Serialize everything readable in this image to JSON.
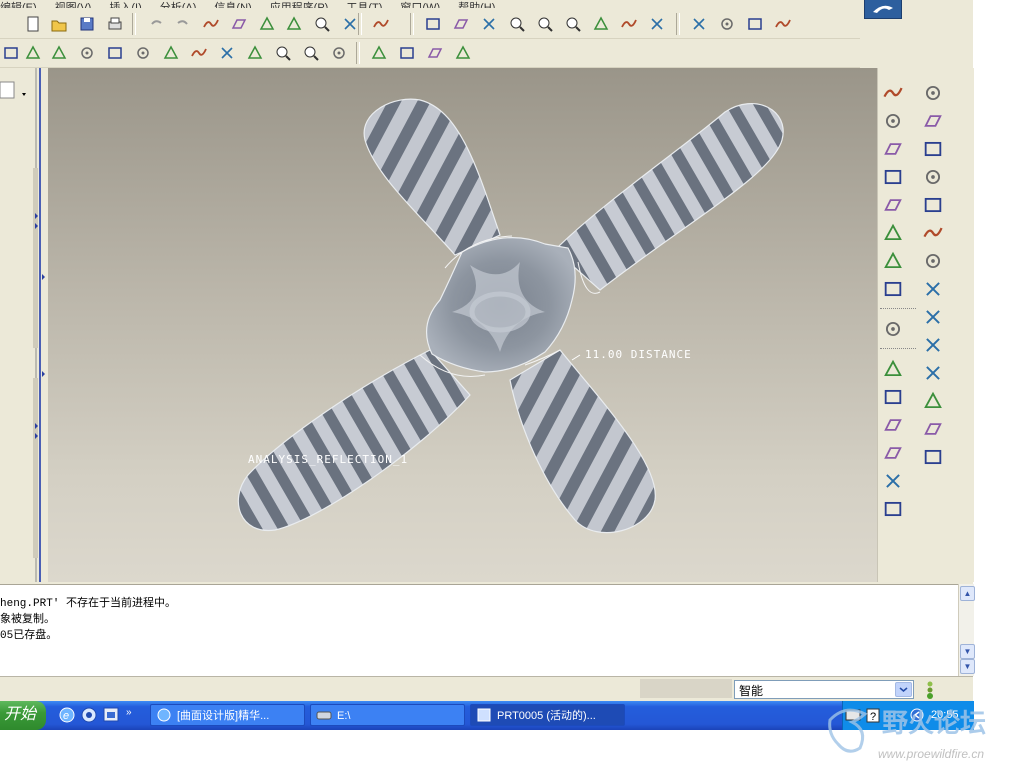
{
  "menubar": {
    "items": [
      "编辑(E)",
      "视图(V)",
      "插入(I)",
      "分析(A)",
      "信息(N)",
      "应用程序(P)",
      "工具(T)",
      "窗口(W)",
      "帮助(H)"
    ]
  },
  "toolbar": {
    "row1": [
      "new-icon",
      "open-icon",
      "save-icon",
      "print-icon",
      "undo-icon",
      "redo-icon",
      "cut-icon",
      "copy-icon",
      "paste-icon",
      "paste-special-icon",
      "find-icon",
      "regenerate-icon",
      "select-box-icon",
      "spin-center-icon",
      "orient-icon",
      "datum-display-icon",
      "zoom-in-icon",
      "zoom-out-icon",
      "refit-icon",
      "repaint-icon",
      "saved-views-icon",
      "layers-icon",
      "wireframe-icon",
      "hidden-line-icon",
      "no-hidden-icon",
      "shading-icon"
    ],
    "row2": [
      "draft-analysis-icon",
      "section-icon",
      "curvature-icon",
      "reflection-icon",
      "shade-analysis-icon",
      "offset-icon",
      "dihedral-icon",
      "ruler-icon",
      "measure-icon",
      "pick-icon",
      "inspect-icon",
      "zoom-detail-icon",
      "close-window-icon",
      "datum-plane-display-icon",
      "axis-display-icon",
      "point-display-icon",
      "csys-display-icon"
    ]
  },
  "viewport": {
    "annotation_reflection": "ANALYSIS_REFLECTION_1",
    "annotation_distance": "11.00  DISTANCE"
  },
  "rightbar": {
    "col1": [
      "datum-point-icon",
      "datum-axis-icon",
      "datum-curve-icon",
      "datum-plane-icon",
      "sketch-line-icon",
      "spline-icon",
      "intersect-icon",
      "offset-point-icon",
      "annotation-icon",
      "extrude-icon",
      "shell-icon",
      "draft-icon",
      "rib-icon",
      "round-icon",
      "chamfer-icon"
    ],
    "col2": [
      "coord-icon",
      "rotate-icon",
      "sweep-icon",
      "blend-icon",
      "boundary-icon",
      "pattern-icon",
      "copy-surface-icon",
      "merge-icon",
      "trim-icon",
      "extend-icon",
      "thicken-icon",
      "solidify-icon",
      "add-icon",
      "cylinder-icon"
    ]
  },
  "messages": [
    {
      "text": "heng.PRT' 不存在于当前进程中。"
    },
    {
      "text": "象被复制。"
    },
    {
      "text": "05已存盘。"
    }
  ],
  "status": {
    "filter_value": "智能"
  },
  "taskbar": {
    "start_label": "开始",
    "tasks": [
      {
        "label": "[曲面设计版]精华..."
      },
      {
        "label": "E:\\"
      },
      {
        "label": "PRT0005 (活动的)..."
      }
    ],
    "clock": "20:55"
  },
  "watermark": {
    "title": "野火论坛",
    "url": "www.proewildfire.cn"
  },
  "colors": {
    "taskbar": "#245edc",
    "start": "#3a9a38",
    "model_dark": "#68707e",
    "model_light": "#c9cdd6"
  }
}
